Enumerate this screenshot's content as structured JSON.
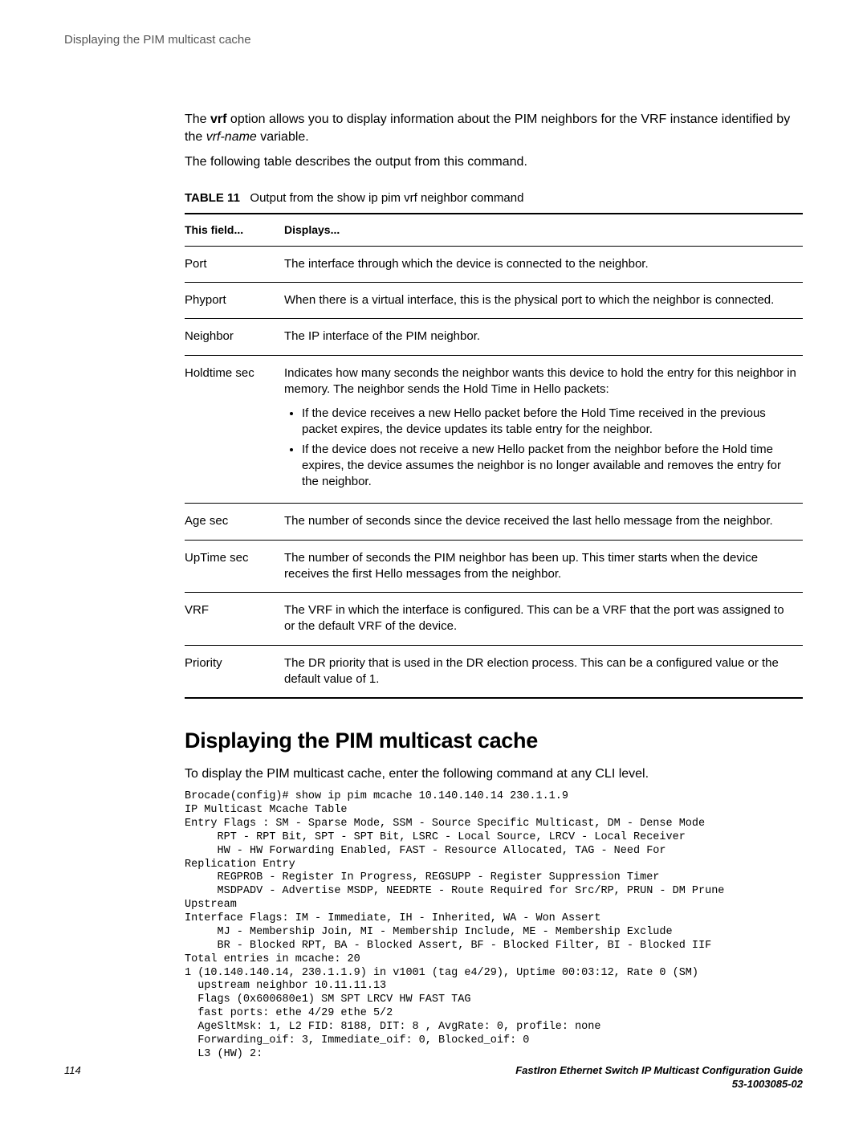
{
  "header": {
    "title": "Displaying the PIM multicast cache"
  },
  "intro": {
    "line1_prefix": "The ",
    "line1_bold": "vrf",
    "line1_mid": " option allows you to display information about the PIM neighbors for the VRF instance identified by the ",
    "line1_italic": "vrf-name",
    "line1_suffix": " variable.",
    "line2": "The following table describes the output from this command."
  },
  "table": {
    "caption_label": "TABLE 11",
    "caption_text": "Output from the show ip pim vrf neighbor command",
    "head_field": "This field...",
    "head_displays": "Displays...",
    "rows": [
      {
        "field": "Port",
        "desc": "The interface through which the device is connected to the neighbor."
      },
      {
        "field": "Phyport",
        "desc": "When there is a virtual interface, this is the physical port to which the neighbor is connected."
      },
      {
        "field": "Neighbor",
        "desc": "The IP interface of the PIM neighbor."
      },
      {
        "field": "Holdtime sec",
        "desc": "Indicates how many seconds the neighbor wants this device to hold the entry for this neighbor in memory. The neighbor sends the Hold Time in Hello packets:",
        "bullets": [
          "If the device receives a new Hello packet before the Hold Time received in the previous packet expires, the device updates its table entry for the neighbor.",
          "If the device does not receive a new Hello packet from the neighbor before the Hold time expires, the device assumes the neighbor is no longer available and removes the entry for the neighbor."
        ]
      },
      {
        "field": "Age sec",
        "desc": "The number of seconds since the device received the last hello message from the neighbor."
      },
      {
        "field": "UpTime sec",
        "desc": "The number of seconds the PIM neighbor has been up. This timer starts when the device receives the first Hello messages from the neighbor."
      },
      {
        "field": "VRF",
        "desc": "The VRF in which the interface is configured. This can be a VRF that the port was assigned to or the default VRF of the device."
      },
      {
        "field": "Priority",
        "desc": "The DR priority that is used in the DR election process. This can be a configured value or the default value of 1."
      }
    ]
  },
  "section": {
    "heading": "Displaying the PIM multicast cache",
    "intro": "To display the PIM multicast cache, enter the following command at any CLI level.",
    "code": "Brocade(config)# show ip pim mcache 10.140.140.14 230.1.1.9\nIP Multicast Mcache Table\nEntry Flags : SM - Sparse Mode, SSM - Source Specific Multicast, DM - Dense Mode\n     RPT - RPT Bit, SPT - SPT Bit, LSRC - Local Source, LRCV - Local Receiver\n     HW - HW Forwarding Enabled, FAST - Resource Allocated, TAG - Need For \nReplication Entry\n     REGPROB - Register In Progress, REGSUPP - Register Suppression Timer\n     MSDPADV - Advertise MSDP, NEEDRTE - Route Required for Src/RP, PRUN - DM Prune \nUpstream\nInterface Flags: IM - Immediate, IH - Inherited, WA - Won Assert\n     MJ - Membership Join, MI - Membership Include, ME - Membership Exclude\n     BR - Blocked RPT, BA - Blocked Assert, BF - Blocked Filter, BI - Blocked IIF\nTotal entries in mcache: 20\n1 (10.140.140.14, 230.1.1.9) in v1001 (tag e4/29), Uptime 00:03:12, Rate 0 (SM)\n  upstream neighbor 10.11.11.13\n  Flags (0x600680e1) SM SPT LRCV HW FAST TAG\n  fast ports: ethe 4/29 ethe 5/2\n  AgeSltMsk: 1, L2 FID: 8188, DIT: 8 , AvgRate: 0, profile: none\n  Forwarding_oif: 3, Immediate_oif: 0, Blocked_oif: 0\n  L3 (HW) 2:"
  },
  "footer": {
    "page": "114",
    "doc1": "FastIron Ethernet Switch IP Multicast Configuration Guide",
    "doc2": "53-1003085-02"
  }
}
